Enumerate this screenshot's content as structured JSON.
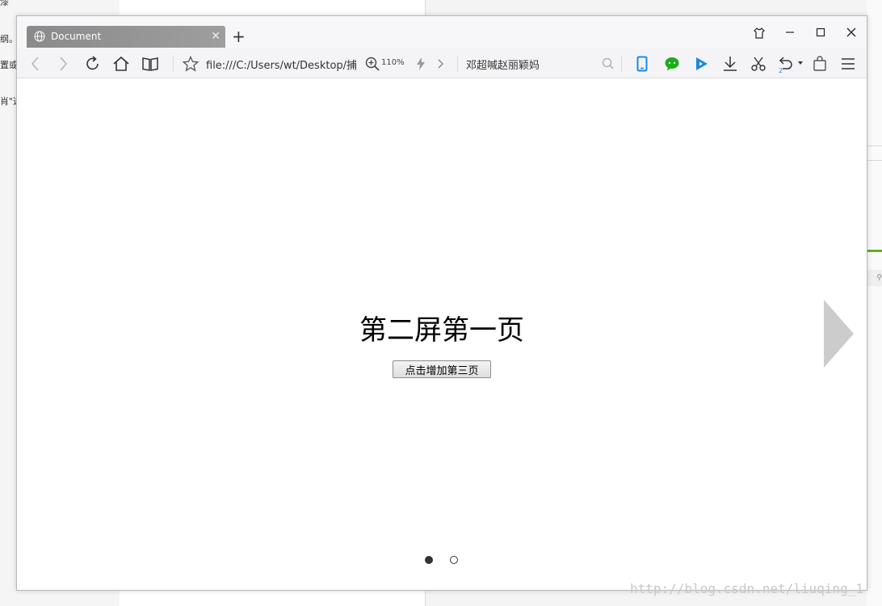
{
  "background": {
    "snippets": [
      "漆",
      "纲。",
      "置或",
      "肖\"选"
    ]
  },
  "tab": {
    "title": "Document",
    "icon": "globe-icon"
  },
  "toolbar": {
    "url": "file:///C:/Users/wt/Desktop/捕",
    "zoom": "110%",
    "search_text": "邓超喊赵丽颖妈",
    "undo_count": "2"
  },
  "page": {
    "heading": "第二屏第一页",
    "button_label": "点击增加第三页",
    "slides_total": 2,
    "active_slide": 1
  },
  "watermark": "http://blog.csdn.net/liuqing_1",
  "colors": {
    "tab_bg": "#8a8a8a",
    "wechat_green": "#1aad19",
    "accent_blue": "#1a88e0",
    "arrow_gray": "#cccccc",
    "bg_green_line": "#6dab1f"
  }
}
